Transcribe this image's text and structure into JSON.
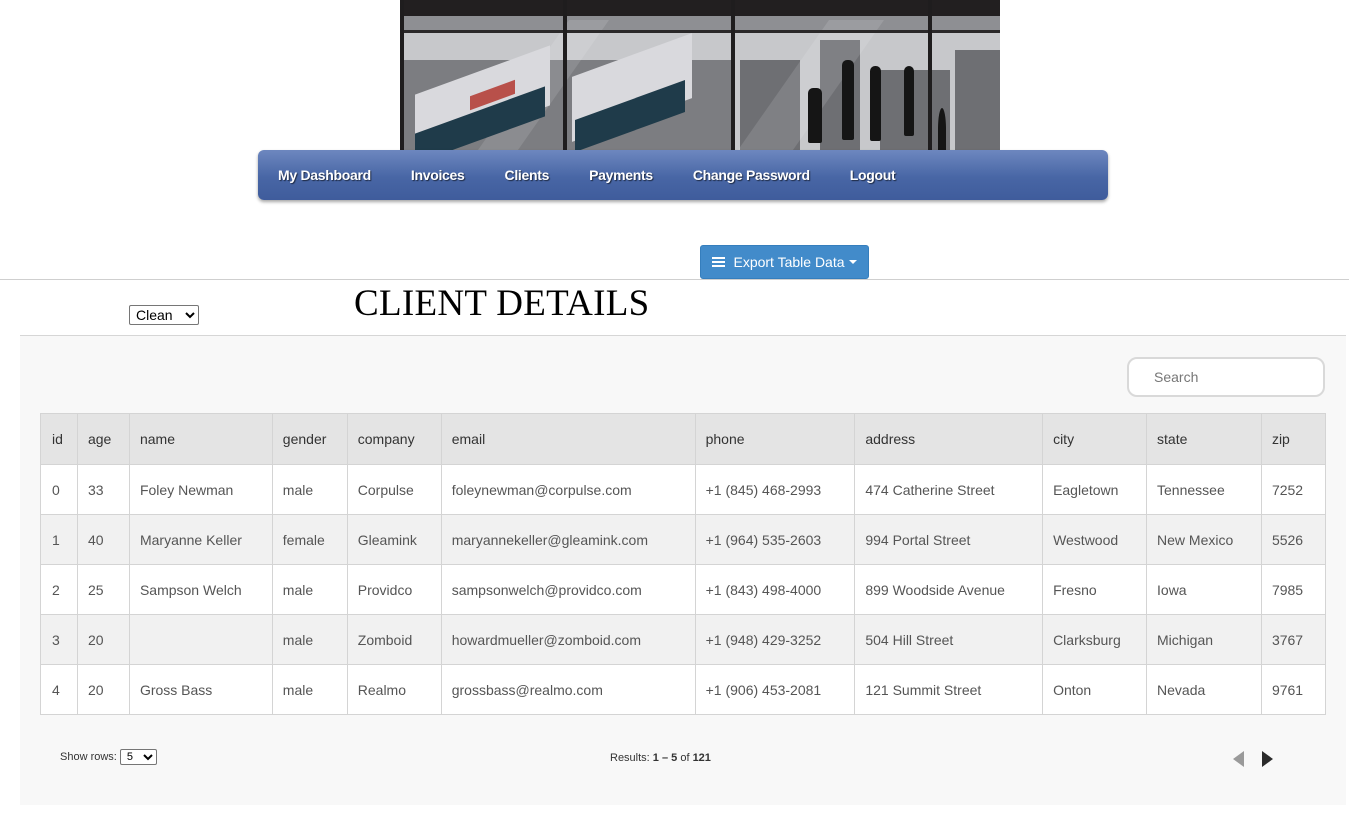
{
  "banner": {
    "alt": "office illustration banner"
  },
  "nav": {
    "items": [
      {
        "label": "My Dashboard"
      },
      {
        "label": "Invoices"
      },
      {
        "label": "Clients"
      },
      {
        "label": "Payments"
      },
      {
        "label": "Change Password"
      },
      {
        "label": "Logout"
      }
    ],
    "gradient_top": "#6d87bf",
    "gradient_bottom": "#3f5c9c"
  },
  "toolbar": {
    "export_label": "Export Table Data",
    "export_icon": "hamburger-icon",
    "export_color": "#428bca"
  },
  "theme_select": {
    "value": "Clean"
  },
  "page_title": "CLIENT DETAILS",
  "search": {
    "placeholder": "Search",
    "value": ""
  },
  "table": {
    "columns": [
      "id",
      "age",
      "name",
      "gender",
      "company",
      "email",
      "phone",
      "address",
      "city",
      "state",
      "zip"
    ],
    "rows": [
      [
        "0",
        "33",
        "Foley Newman",
        "male",
        "Corpulse",
        "foleynewman@corpulse.com",
        "+1 (845) 468-2993",
        "474 Catherine Street",
        "Eagletown",
        "Tennessee",
        "7252"
      ],
      [
        "1",
        "40",
        "Maryanne Keller",
        "female",
        "Gleamink",
        "maryannekeller@gleamink.com",
        "+1 (964) 535-2603",
        "994 Portal Street",
        "Westwood",
        "New Mexico",
        "5526"
      ],
      [
        "2",
        "25",
        "Sampson Welch",
        "male",
        "Providco",
        "sampsonwelch@providco.com",
        "+1 (843) 498-4000",
        "899 Woodside Avenue",
        "Fresno",
        "Iowa",
        "7985"
      ],
      [
        "3",
        "20",
        "",
        "male",
        "Zomboid",
        "howardmueller@zomboid.com",
        "+1 (948) 429-3252",
        "504 Hill Street",
        "Clarksburg",
        "Michigan",
        "3767"
      ],
      [
        "4",
        "20",
        "Gross Bass",
        "male",
        "Realmo",
        "grossbass@realmo.com",
        "+1 (906) 453-2081",
        "121 Summit Street",
        "Onton",
        "Nevada",
        "9761"
      ]
    ]
  },
  "footer": {
    "show_rows_label": "Show rows:",
    "show_rows_value": "5",
    "results_prefix": "Results: ",
    "results_range": "1 – 5",
    "results_of": " of ",
    "results_total": "121",
    "prev_icon": "triangle-left-icon",
    "next_icon": "triangle-right-icon"
  }
}
